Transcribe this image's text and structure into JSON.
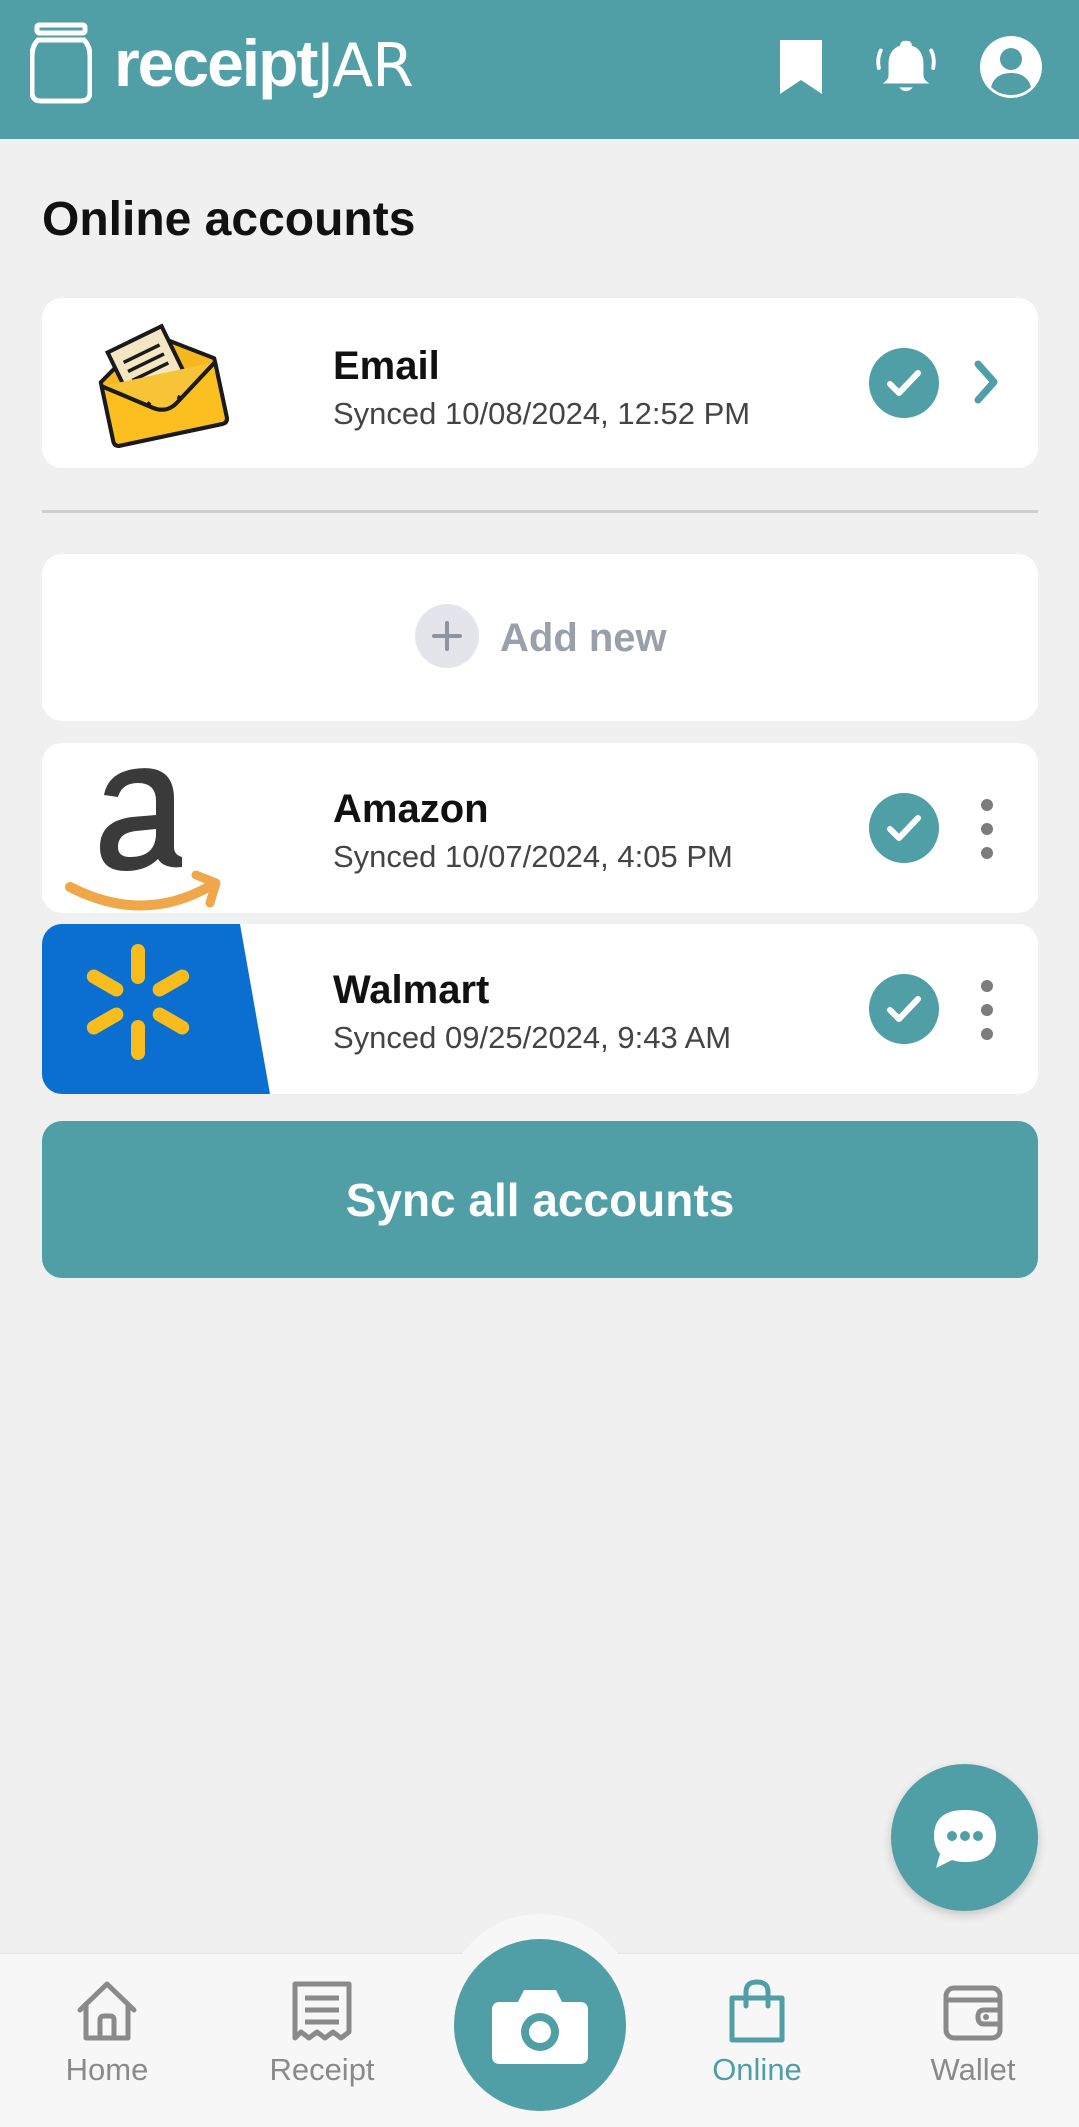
{
  "header": {
    "logo_bold": "receipt",
    "logo_thin": "JAR",
    "icons": [
      "bookmark-icon",
      "bell-icon",
      "profile-icon"
    ]
  },
  "page": {
    "title": "Online accounts"
  },
  "email_account": {
    "name": "Email",
    "synced": "Synced 10/08/2024, 12:52 PM",
    "icon": "envelope-icon"
  },
  "add_new": {
    "label": "Add new",
    "icon": "plus-icon"
  },
  "accounts": [
    {
      "name": "Amazon",
      "synced": "Synced 10/07/2024, 4:05 PM",
      "logo": "amazon-logo"
    },
    {
      "name": "Walmart",
      "synced": "Synced 09/25/2024, 9:43 AM",
      "logo": "walmart-logo"
    }
  ],
  "sync_button": {
    "label": "Sync all accounts"
  },
  "chat": {
    "icon": "chat-icon"
  },
  "bottom_nav": {
    "items": [
      {
        "label": "Home",
        "icon": "home-icon"
      },
      {
        "label": "Receipt",
        "icon": "receipt-icon"
      },
      {
        "label": "",
        "icon": "camera-icon"
      },
      {
        "label": "Online",
        "icon": "shopping-bag-icon",
        "active": true
      },
      {
        "label": "Wallet",
        "icon": "wallet-icon"
      }
    ]
  },
  "colors": {
    "brand": "#509ea6",
    "background": "#f0f0f0",
    "muted": "#9aa0aa",
    "email_yellow": "#f5b820",
    "walmart_blue": "#0a6fd1",
    "walmart_yellow": "#f9bc1d",
    "amazon_orange": "#f0a74a"
  }
}
